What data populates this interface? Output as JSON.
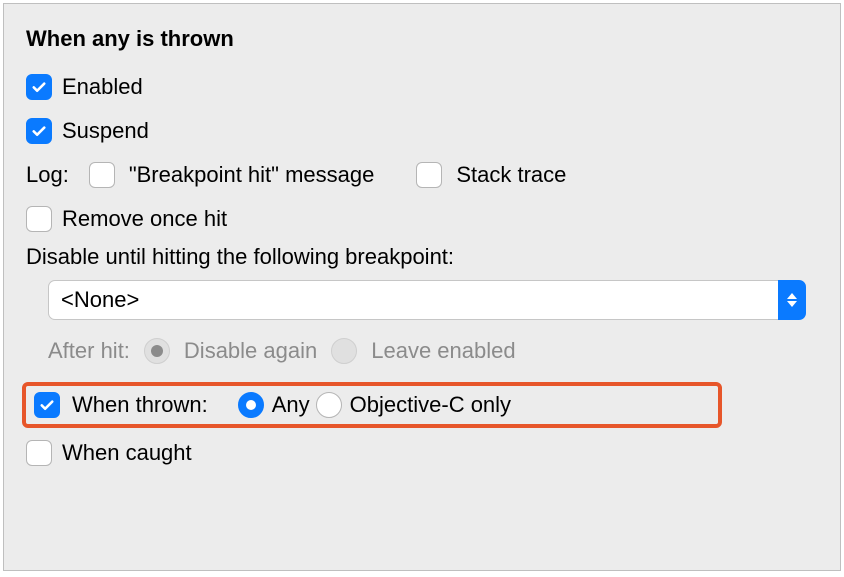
{
  "title": "When any is thrown",
  "enabled_label": "Enabled",
  "suspend_label": "Suspend",
  "log_label": "Log:",
  "log_breakpoint_hit": "\"Breakpoint hit\" message",
  "log_stack_trace": "Stack trace",
  "remove_once_hit": "Remove once hit",
  "disable_until_text": "Disable until hitting the following breakpoint:",
  "select_value": "<None>",
  "after_hit_label": "After hit:",
  "disable_again": "Disable again",
  "leave_enabled": "Leave enabled",
  "when_thrown_label": "When thrown:",
  "any_label": "Any",
  "objc_only_label": "Objective-C only",
  "when_caught_label": "When caught",
  "state": {
    "enabled": true,
    "suspend": true,
    "log_breakpoint_hit": false,
    "log_stack_trace": false,
    "remove_once_hit": false,
    "disable_until": "<None>",
    "after_hit": "disable_again",
    "after_hit_enabled": false,
    "when_thrown": true,
    "when_thrown_mode": "any",
    "when_caught": false
  }
}
